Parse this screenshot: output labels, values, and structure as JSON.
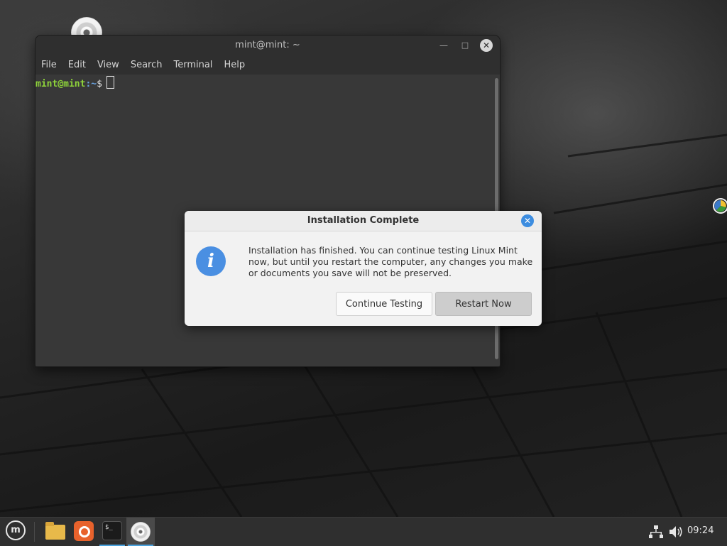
{
  "terminal": {
    "title": "mint@mint: ~",
    "menu": [
      "File",
      "Edit",
      "View",
      "Search",
      "Terminal",
      "Help"
    ],
    "prompt_user": "mint@mint",
    "prompt_path": ":~",
    "prompt_symbol": "$"
  },
  "dialog": {
    "title": "Installation Complete",
    "message": "Installation has finished.  You can continue testing Linux Mint now, but until you restart the computer, any changes you make or documents you save will not be preserved.",
    "continue_label": "Continue Testing",
    "restart_label": "Restart Now"
  },
  "taskbar": {
    "menu_icon": "linux-mint-logo-icon",
    "apps": [
      "files-icon",
      "firefox-icon",
      "terminal-icon",
      "disc-installer-icon"
    ],
    "terminal_icon_text": "$_",
    "clock": "09:24"
  },
  "colors": {
    "accent": "#4aa3df",
    "prompt_user": "#8ed33a",
    "prompt_path": "#6aa3e0",
    "info_icon": "#4a8fe2"
  }
}
